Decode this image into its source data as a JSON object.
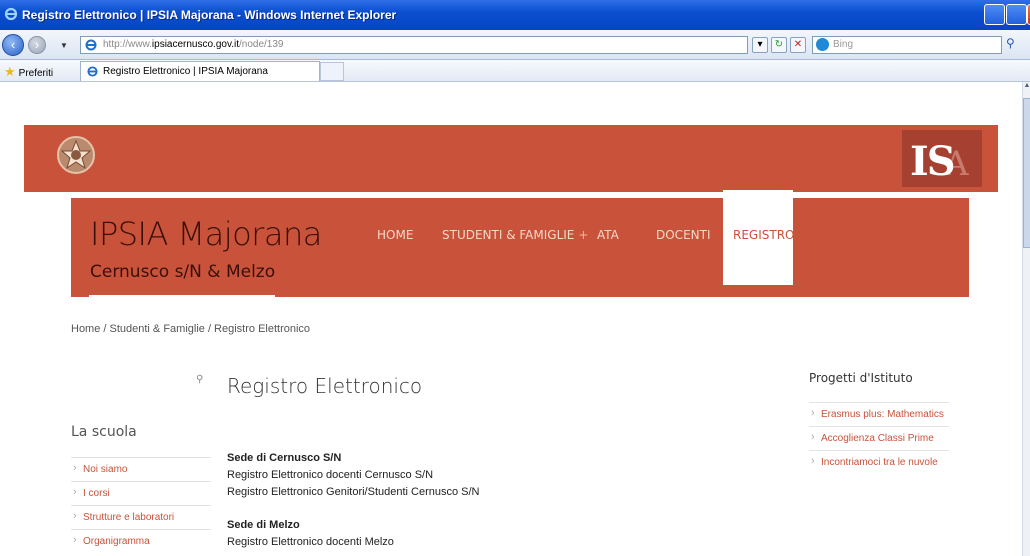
{
  "window": {
    "title": "Registro Elettronico | IPSIA Majorana - Windows Internet Explorer"
  },
  "addressbar": {
    "url_prefix": "http://www.",
    "url_host": "ipsiacernusco.gov.it",
    "url_path": "/node/139",
    "search_placeholder": "Bing"
  },
  "favorites": {
    "label": "Preferiti",
    "tab_title": "Registro Elettronico | IPSIA Majorana"
  },
  "site": {
    "name": "IPSIA Majorana",
    "slogan": "Cernusco s/N & Melzo",
    "logo_text": "IS",
    "logo_extra": "A"
  },
  "menu": [
    {
      "label": "HOME"
    },
    {
      "label": "STUDENTI & FAMIGLIE",
      "plus": "+"
    },
    {
      "label": "ATA"
    },
    {
      "label": "DOCENTI"
    },
    {
      "label": "REGISTRO"
    }
  ],
  "breadcrumb": "Home / Studenti & Famiglie / Registro Elettronico",
  "sidebar": {
    "title": "La scuola",
    "items": [
      "Noi siamo",
      "I corsi",
      "Strutture e laboratori",
      "Organigramma"
    ]
  },
  "content": {
    "title": "Registro Elettronico",
    "sede1": "Sede di Cernusco S/N",
    "link1": "Registro Elettronico docenti Cernusco S/N",
    "link2": "Registro Elettronico Genitori/Studenti Cernusco S/N",
    "sede2": "Sede di Melzo",
    "link3": "Registro Elettronico docenti Melzo"
  },
  "rightbar": {
    "title": "Progetti d'Istituto",
    "items": [
      "Erasmus plus: Mathematics",
      "Accoglienza Classi Prime",
      "Incontriamoci tra le nuvole"
    ]
  },
  "colors": {
    "brand": "#c9523a",
    "header_text": "#3a0f08"
  }
}
